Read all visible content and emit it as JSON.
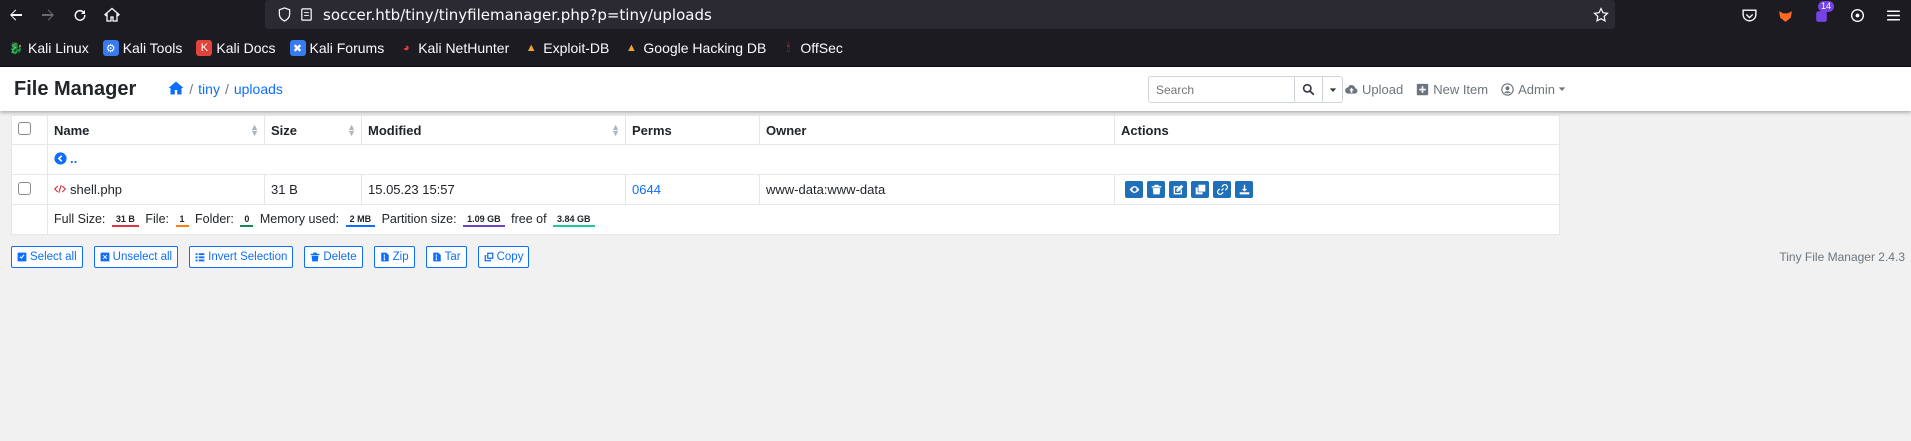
{
  "browser": {
    "url": "soccer.htb/tiny/tinyfilemanager.php?p=tiny/uploads",
    "extension_badge": "14"
  },
  "bookmarks": [
    {
      "label": "Kali Linux",
      "color": "#367bf0"
    },
    {
      "label": "Kali Tools",
      "color": "#e2433b"
    },
    {
      "label": "Kali Docs",
      "color": "#e2433b"
    },
    {
      "label": "Kali Forums",
      "color": "#367bf0"
    },
    {
      "label": "Kali NetHunter",
      "color": "#e2433b"
    },
    {
      "label": "Exploit-DB",
      "color": "#f1a530"
    },
    {
      "label": "Google Hacking DB",
      "color": "#f1a530"
    },
    {
      "label": "OffSec",
      "color": "#e2433b"
    }
  ],
  "app": {
    "brand": "File Manager",
    "breadcrumb": [
      "tiny",
      "uploads"
    ],
    "search_placeholder": "Search",
    "upload_label": "Upload",
    "new_item_label": "New Item",
    "admin_label": "Admin"
  },
  "table": {
    "headers": {
      "name": "Name",
      "size": "Size",
      "modified": "Modified",
      "perms": "Perms",
      "owner": "Owner",
      "actions": "Actions"
    },
    "parent_link": "..",
    "rows": [
      {
        "name": "shell.php",
        "size": "31 B",
        "modified": "15.05.23 15:57",
        "perms": "0644",
        "owner": "www-data:www-data"
      }
    ],
    "stats": {
      "full_size_label": "Full Size:",
      "full_size": "31 B",
      "file_label": "File:",
      "file": "1",
      "folder_label": "Folder:",
      "folder": "0",
      "memory_label": "Memory used:",
      "memory": "2 MB",
      "partition_label": "Partition size:",
      "partition": "1.09 GB",
      "free_label": "free of",
      "free": "3.84 GB"
    }
  },
  "buttons": {
    "select_all": "Select all",
    "unselect_all": "Unselect all",
    "invert": "Invert Selection",
    "delete": "Delete",
    "zip": "Zip",
    "tar": "Tar",
    "copy": "Copy"
  },
  "version": "Tiny File Manager 2.4.3",
  "colors": {
    "link": "#0d6efd",
    "icon_btn": "#1f70b8",
    "badge_red": "#dc3545",
    "badge_orange": "#fd7e14",
    "badge_green": "#198754",
    "badge_blue": "#0d6efd",
    "badge_purple": "#6f42c1",
    "badge_teal": "#20c997"
  }
}
